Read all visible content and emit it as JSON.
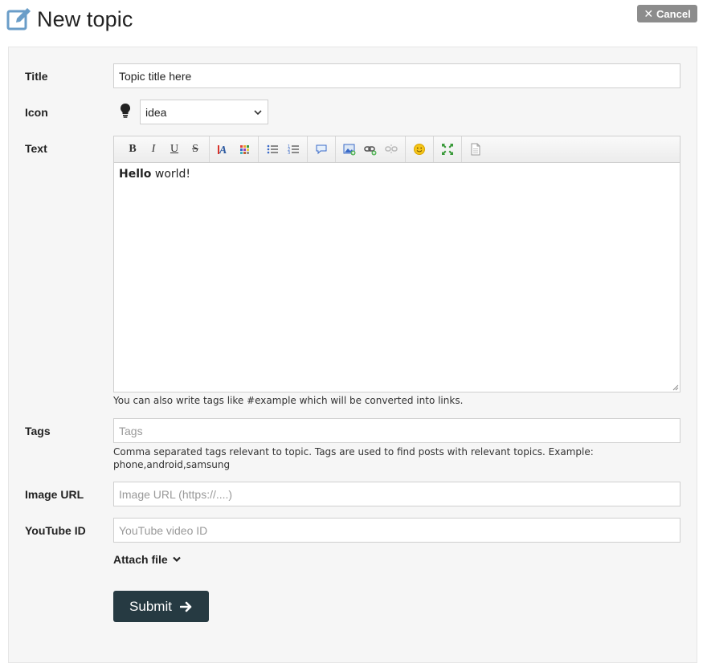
{
  "header": {
    "title": "New topic",
    "cancel_label": "Cancel"
  },
  "form": {
    "title": {
      "label": "Title",
      "value": "Topic title here"
    },
    "icon": {
      "label": "Icon",
      "selected": "idea"
    },
    "text": {
      "label": "Text",
      "content_bold": "Hello",
      "content_rest": " world!",
      "help": "You can also write tags like #example which will be converted into links."
    },
    "tags": {
      "label": "Tags",
      "placeholder": "Tags",
      "help": "Comma separated tags relevant to topic. Tags are used to find posts with relevant topics. Example: phone,android,samsung"
    },
    "image_url": {
      "label": "Image URL",
      "placeholder": "Image URL (https://....)"
    },
    "youtube": {
      "label": "YouTube ID",
      "placeholder": "YouTube video ID"
    },
    "attach_label": "Attach file",
    "submit_label": "Submit"
  },
  "toolbar": {
    "bold": "B",
    "italic": "I",
    "underline": "U",
    "strike": "S",
    "icons": [
      "text-color-icon",
      "bg-color-icon",
      "bullet-list-icon",
      "numbered-list-icon",
      "quote-icon",
      "image-icon",
      "link-icon",
      "unlink-icon",
      "emoji-icon",
      "maximize-icon",
      "source-icon"
    ]
  },
  "colors": {
    "submit_bg": "#263a42",
    "cancel_bg": "#8c8c8c",
    "edit_icon": "#4a8ec5",
    "panel_bg": "#f6f6f6"
  }
}
